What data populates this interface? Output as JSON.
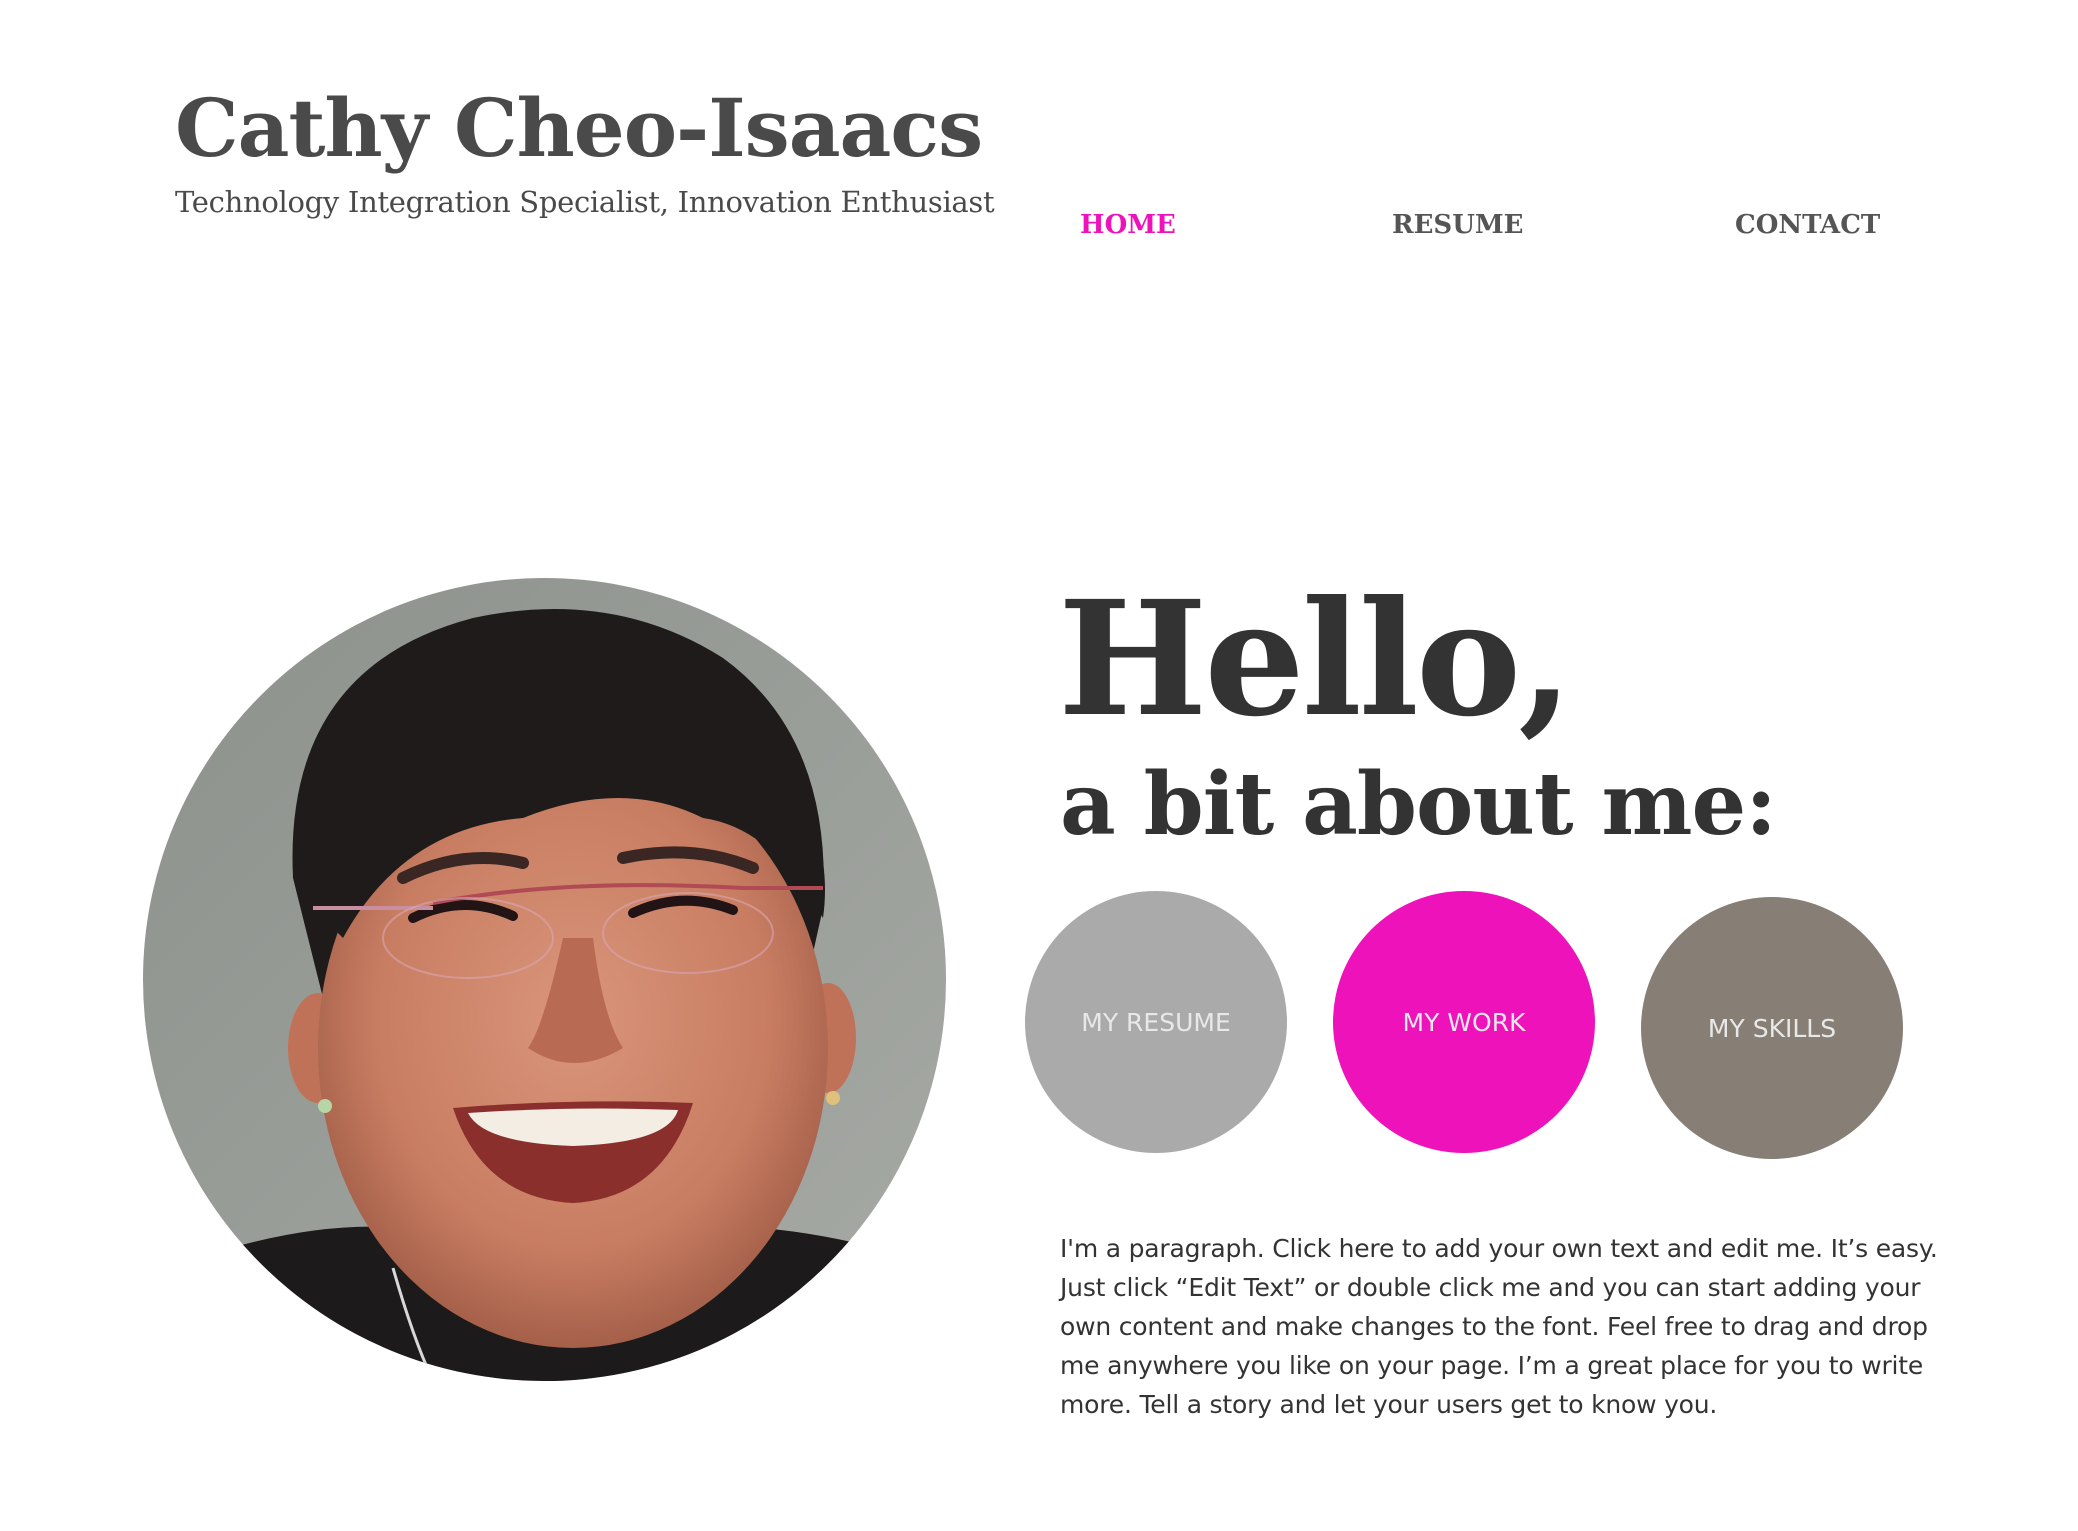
{
  "header": {
    "site_title": "Cathy Cheo-Isaacs",
    "tagline": "Technology Integration Specialist, Innovation Enthusiast"
  },
  "nav": {
    "items": [
      {
        "label": "HOME",
        "active": true
      },
      {
        "label": "RESUME",
        "active": false
      },
      {
        "label": "CONTACT",
        "active": false
      }
    ]
  },
  "colors": {
    "accent": "#ee12ba",
    "text": "#333333",
    "resume_button": "#aaaaaa",
    "work_button": "#ee12ba",
    "skills_button": "#877f75"
  },
  "main": {
    "heading": "Hello,",
    "subheading": "a bit about me:",
    "buttons": [
      {
        "label": "MY RESUME",
        "color": "#aaaaaa"
      },
      {
        "label": "MY WORK",
        "color": "#ee12ba"
      },
      {
        "label": "MY SKILLS",
        "color": "#877f75"
      }
    ],
    "paragraph": "I'm a paragraph. Click here to add your own text and edit me. It’s easy. Just click “Edit Text” or double click me and you can start adding your own content and make changes to the font. Feel free to drag and drop me anywhere you like on your page. I’m a great place for you to write more. Tell a story and let your users get to know you."
  }
}
